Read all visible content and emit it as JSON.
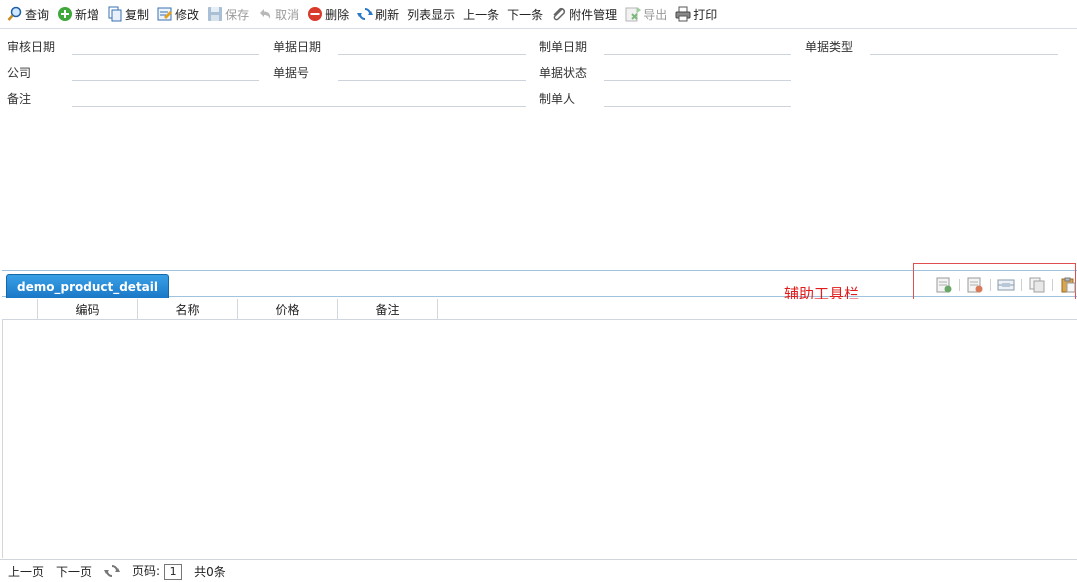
{
  "toolbar": {
    "query": "查询",
    "add": "新增",
    "copy": "复制",
    "edit": "修改",
    "save": "保存",
    "cancel": "取消",
    "delete": "删除",
    "refresh": "刷新",
    "list_view": "列表显示",
    "prev_record": "上一条",
    "next_record": "下一条",
    "attachments": "附件管理",
    "export": "导出",
    "print": "打印"
  },
  "form": {
    "audit_date": "审核日期",
    "doc_date": "单据日期",
    "create_date": "制单日期",
    "doc_type": "单据类型",
    "company": "公司",
    "doc_no": "单据号",
    "doc_status": "单据状态",
    "remark": "备注",
    "creator": "制单人"
  },
  "detail": {
    "tab_label": "demo_product_detail",
    "helper_label": "辅助工具栏",
    "columns": [
      "编码",
      "名称",
      "价格",
      "备注"
    ]
  },
  "pager": {
    "prev_page": "上一页",
    "next_page": "下一页",
    "page_label": "页码:",
    "page_number": "1",
    "total": "共0条"
  }
}
